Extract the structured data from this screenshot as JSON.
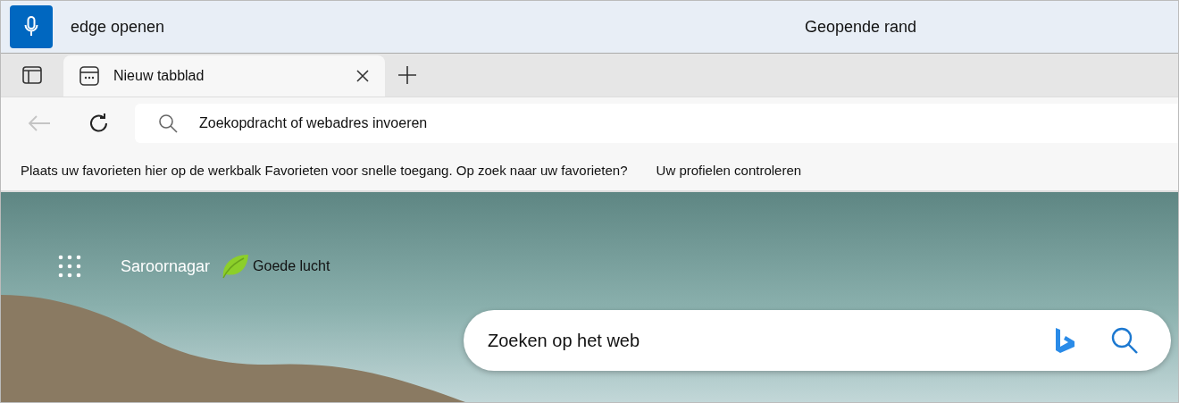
{
  "voice_bar": {
    "query": "edge openen",
    "response": "Geopende rand"
  },
  "tabs": [
    {
      "label": "Nieuw tabblad",
      "selected": true
    }
  ],
  "navigation": {
    "back_disabled": true
  },
  "address_bar": {
    "placeholder": "Zoekopdracht of webadres invoeren"
  },
  "favorites_bar": {
    "message": "Plaats uw favorieten hier op de werkbalk Favorieten voor snelle toegang. Op zoek naar uw favorieten?",
    "link": "Uw profielen controleren"
  },
  "new_tab_page": {
    "location": "Saroornagar",
    "air_quality": "Goede lucht",
    "search": {
      "placeholder": "Zoeken op het web"
    }
  }
}
